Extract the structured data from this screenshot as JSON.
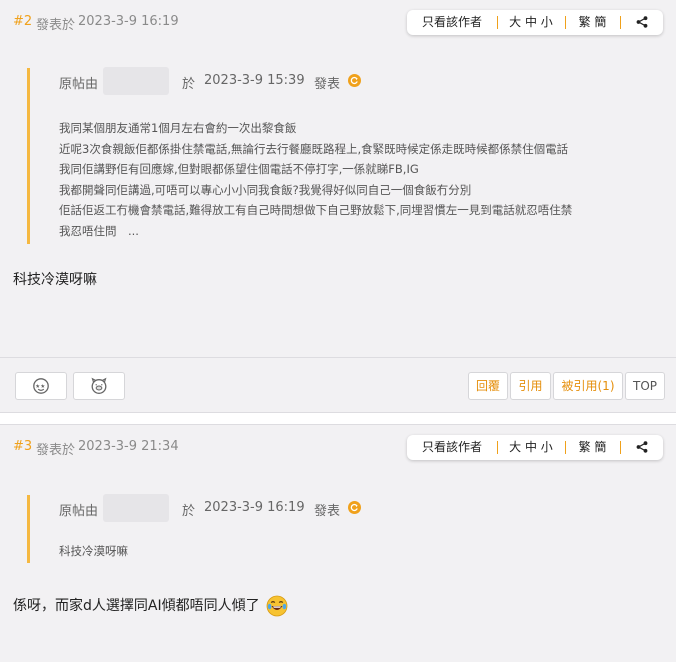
{
  "posts": [
    {
      "floor": "#2",
      "posted_label": "發表於",
      "posted_time": "2023-3-9 16:19",
      "toolbar": {
        "author_only": "只看該作者",
        "font_size": "大 中 小",
        "trad_simp": "繁 簡",
        "share_icon": "share-icon"
      },
      "quote": {
        "from_label": "原帖由",
        "at_label": "於",
        "time": "2023-3-9 15:39",
        "posted_label": "發表",
        "lines": [
          "我同某個朋友通常1個月左右會約一次出黎食飯",
          "近呢3次食親飯佢都係掛住禁電話,無論行去行餐廳既路程上,食緊既時候定係走既時候都係禁住個電話",
          "我同佢講野佢有回應嫁,但對眼都係望住個電話不停打字,一係就睇FB,IG",
          "我都開聲同佢講過,可唔可以專心小小同我食飯?我覺得好似同自己一個食飯冇分別",
          "佢話佢返工冇機會禁電話,難得放工有自己時間想做下自己野放鬆下,同埋習慣左一見到電話就忍唔住禁",
          "我忍唔住問　..."
        ]
      },
      "content": "科技冷漠呀嘛",
      "footer": {
        "reactions": [
          "emoji-face-icon",
          "pig-face-icon"
        ],
        "reply": "回覆",
        "cite": "引用",
        "cited": "被引用(1)",
        "top": "TOP"
      }
    },
    {
      "floor": "#3",
      "posted_label": "發表於",
      "posted_time": "2023-3-9 21:34",
      "toolbar": {
        "author_only": "只看該作者",
        "font_size": "大 中 小",
        "trad_simp": "繁 簡",
        "share_icon": "share-icon"
      },
      "quote": {
        "from_label": "原帖由",
        "at_label": "於",
        "time": "2023-3-9 16:19",
        "posted_label": "發表",
        "lines": [
          "科技冷漠呀嘛"
        ]
      },
      "content": "係呀，而家d人選擇同AI傾都唔同人傾了",
      "content_emoji": "laughing-tears-emoji"
    }
  ],
  "colors": {
    "accent": "#f0a11b",
    "background": "#f2f1f3",
    "text": "#222222",
    "muted": "#8a8a8a"
  }
}
